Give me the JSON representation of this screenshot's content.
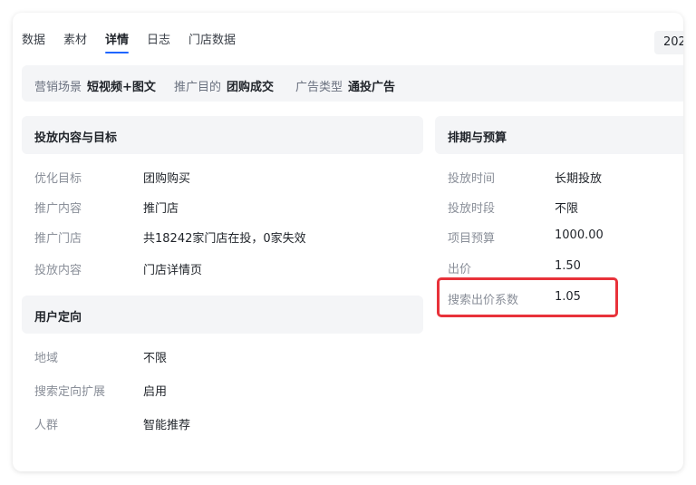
{
  "tabs": [
    {
      "label": "数据"
    },
    {
      "label": "素材"
    },
    {
      "label": "详情"
    },
    {
      "label": "日志"
    },
    {
      "label": "门店数据"
    }
  ],
  "date_badge": "202",
  "summary": {
    "scene_key": "营销场景",
    "scene_val": "短视频+图文",
    "purpose_key": "推广目的",
    "purpose_val": "团购成交",
    "adtype_key": "广告类型",
    "adtype_val": "通投广告"
  },
  "content": {
    "title": "投放内容与目标",
    "rows": [
      {
        "key": "优化目标",
        "value": "团购购买"
      },
      {
        "key": "推广内容",
        "value": "推门店"
      },
      {
        "key": "推广门店",
        "value": "共18242家门店在投，0家失效"
      },
      {
        "key": "投放内容",
        "value": "门店详情页"
      }
    ]
  },
  "targeting": {
    "title": "用户定向",
    "rows": [
      {
        "key": "地域",
        "value": "不限"
      },
      {
        "key": "搜索定向扩展",
        "value": "启用"
      },
      {
        "key": "人群",
        "value": "智能推荐"
      }
    ]
  },
  "schedule": {
    "title": "排期与预算",
    "rows": [
      {
        "key": "投放时间",
        "value": "长期投放"
      },
      {
        "key": "投放时段",
        "value": "不限"
      },
      {
        "key": "项目预算",
        "value": "1000.00"
      },
      {
        "key": "出价",
        "value": "1.50"
      },
      {
        "key": "搜索出价系数",
        "value": "1.05"
      }
    ]
  },
  "colors": {
    "accent": "#1f66ff",
    "highlight": "#e8323a",
    "panel_bg": "#f4f5f7"
  }
}
